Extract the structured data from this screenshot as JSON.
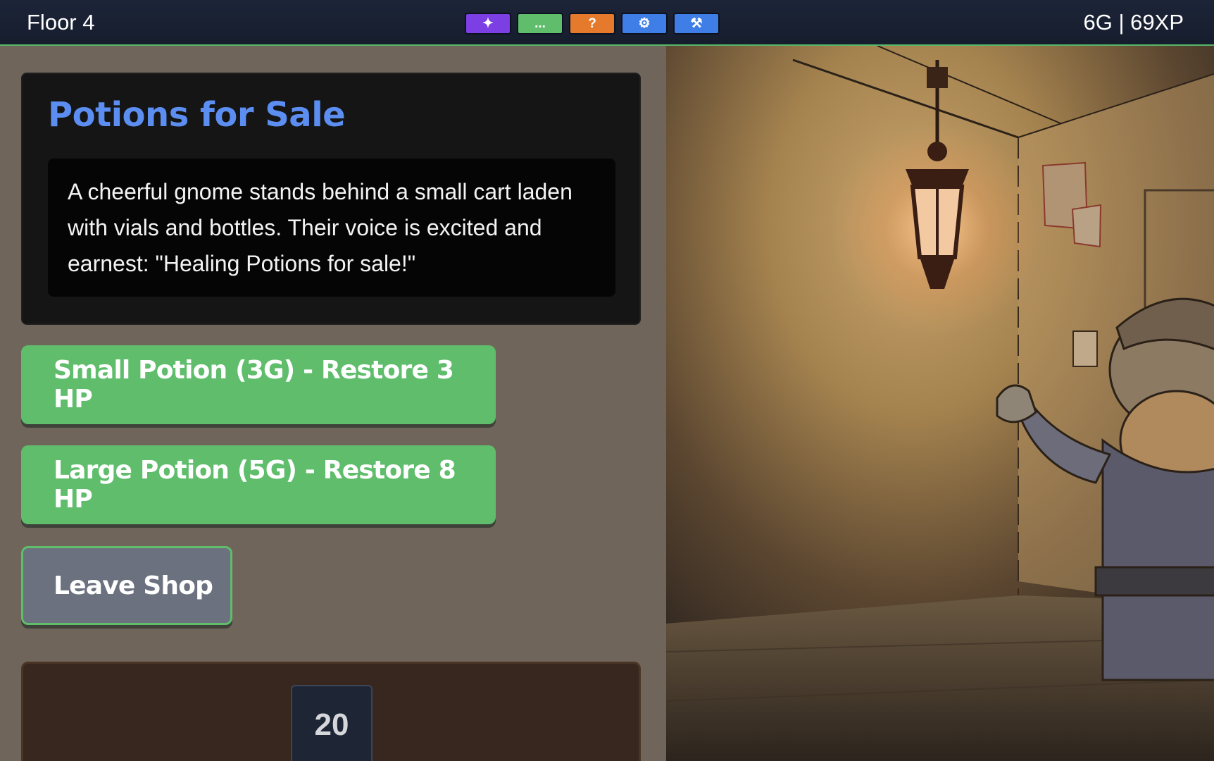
{
  "topbar": {
    "floor": "Floor 4",
    "stats": "6G | 69XP",
    "tools": [
      {
        "glyph": "✦",
        "icon": "sparkle-icon",
        "color": "#7b3fe4"
      },
      {
        "glyph": "...",
        "icon": "ellipsis-icon",
        "color": "#5fbd6c"
      },
      {
        "glyph": "?",
        "icon": "help-icon",
        "color": "#e57a2c"
      },
      {
        "glyph": "⚙",
        "icon": "gear-icon",
        "color": "#3f7ee6"
      },
      {
        "glyph": "⚒",
        "icon": "tools-icon",
        "color": "#3f7ee6"
      }
    ]
  },
  "shop": {
    "title": "Potions for Sale",
    "description": "A cheerful gnome stands behind a small cart laden with vials and bottles. Their voice is excited and earnest: \"Healing Potions for sale!\""
  },
  "actions": {
    "small_potion": "Small Potion (3G) - Restore 3 HP",
    "large_potion": "Large Potion (5G) - Restore 8 HP",
    "leave": "Leave Shop"
  },
  "dice": {
    "value": "20"
  },
  "colors": {
    "accent_green": "#5fbd6c",
    "title_blue": "#5c8ef2",
    "panel_bg": "#6f655b"
  }
}
